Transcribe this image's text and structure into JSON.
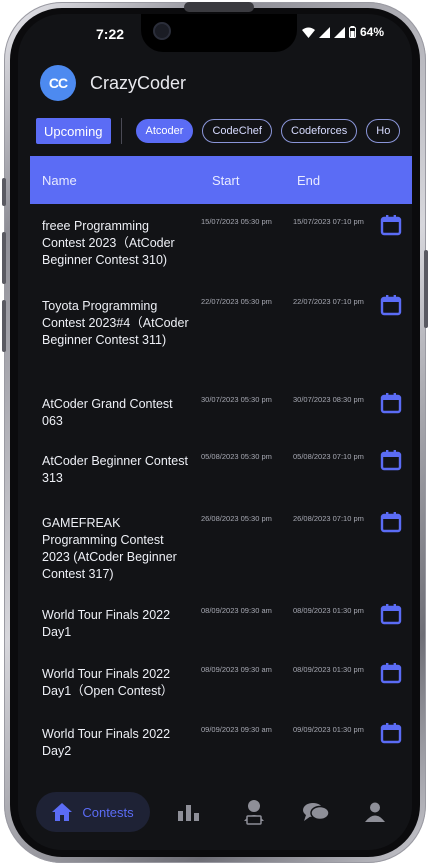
{
  "status_bar": {
    "time": "7:22",
    "battery": "64%"
  },
  "app": {
    "logo_text": "CC",
    "title": "CrazyCoder"
  },
  "filters": {
    "upcoming_label": "Upcoming",
    "platforms": [
      "Atcoder",
      "CodeChef",
      "Codeforces",
      "Ho"
    ],
    "active_platform": "Atcoder"
  },
  "table": {
    "headers": {
      "name": "Name",
      "start": "Start",
      "end": "End"
    },
    "rows": [
      {
        "name": "freee Programming Contest 2023（AtCoder Beginner Contest 310)",
        "start": "15/07/2023 05:30 pm",
        "end": "15/07/2023 07:10 pm"
      },
      {
        "name": "Toyota Programming Contest 2023#4（AtCoder Beginner Contest 311)",
        "start": "22/07/2023 05:30 pm",
        "end": "22/07/2023 07:10 pm"
      },
      {
        "name": "AtCoder Grand Contest 063",
        "start": "30/07/2023 05:30 pm",
        "end": "30/07/2023 08:30 pm"
      },
      {
        "name": "AtCoder Beginner Contest 313",
        "start": "05/08/2023 05:30 pm",
        "end": "05/08/2023 07:10 pm"
      },
      {
        "name": "GAMEFREAK Programming Contest 2023 (AtCoder Beginner Contest 317)",
        "start": "26/08/2023 05:30 pm",
        "end": "26/08/2023 07:10 pm"
      },
      {
        "name": "World Tour Finals 2022 Day1",
        "start": "08/09/2023 09:30 am",
        "end": "08/09/2023 01:30 pm"
      },
      {
        "name": "World Tour Finals 2022 Day1（Open Contest）",
        "start": "08/09/2023 09:30 am",
        "end": "08/09/2023 01:30 pm"
      },
      {
        "name": "World Tour Finals 2022 Day2",
        "start": "09/09/2023 09:30 am",
        "end": "09/09/2023 01:30 pm"
      }
    ]
  },
  "bottom_nav": {
    "contests_label": "Contests",
    "items": [
      "home-icon",
      "bar-chart-icon",
      "coder-icon",
      "chat-icon",
      "profile-icon"
    ]
  },
  "colors": {
    "accent": "#5b6cf5",
    "background": "#121316",
    "logo": "#4d8af0"
  }
}
